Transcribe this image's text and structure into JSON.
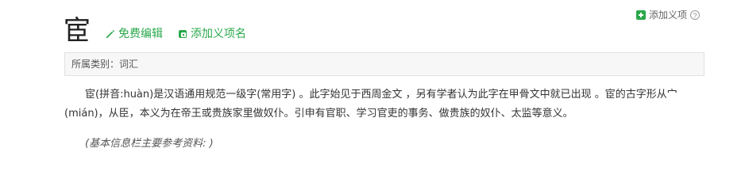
{
  "header": {
    "add_item_label": "添加义项",
    "help_icon": "?"
  },
  "entry": {
    "title_char": "宦",
    "free_edit_label": "免费编辑",
    "add_name_label": "添加义项名"
  },
  "meta": {
    "category_text": "所属类别：词汇"
  },
  "content": {
    "paragraph": "宦(拼音:huàn)是汉语通用规范一级字(常用字) 。此字始见于西周金文 ，另有学者认为此字在甲骨文中就已出现 。宦的古字形从宀(mián)，从臣，本义为在帝王或贵族家里做奴仆。引申有官职、学习官吏的事务、做贵族的奴仆、太监等意义。",
    "note": "(基本信息栏主要参考资料: )"
  },
  "colors": {
    "accent_green": "#2aa84b",
    "meta_background": "#f7f7f7",
    "meta_border": "#e1e1e1"
  }
}
